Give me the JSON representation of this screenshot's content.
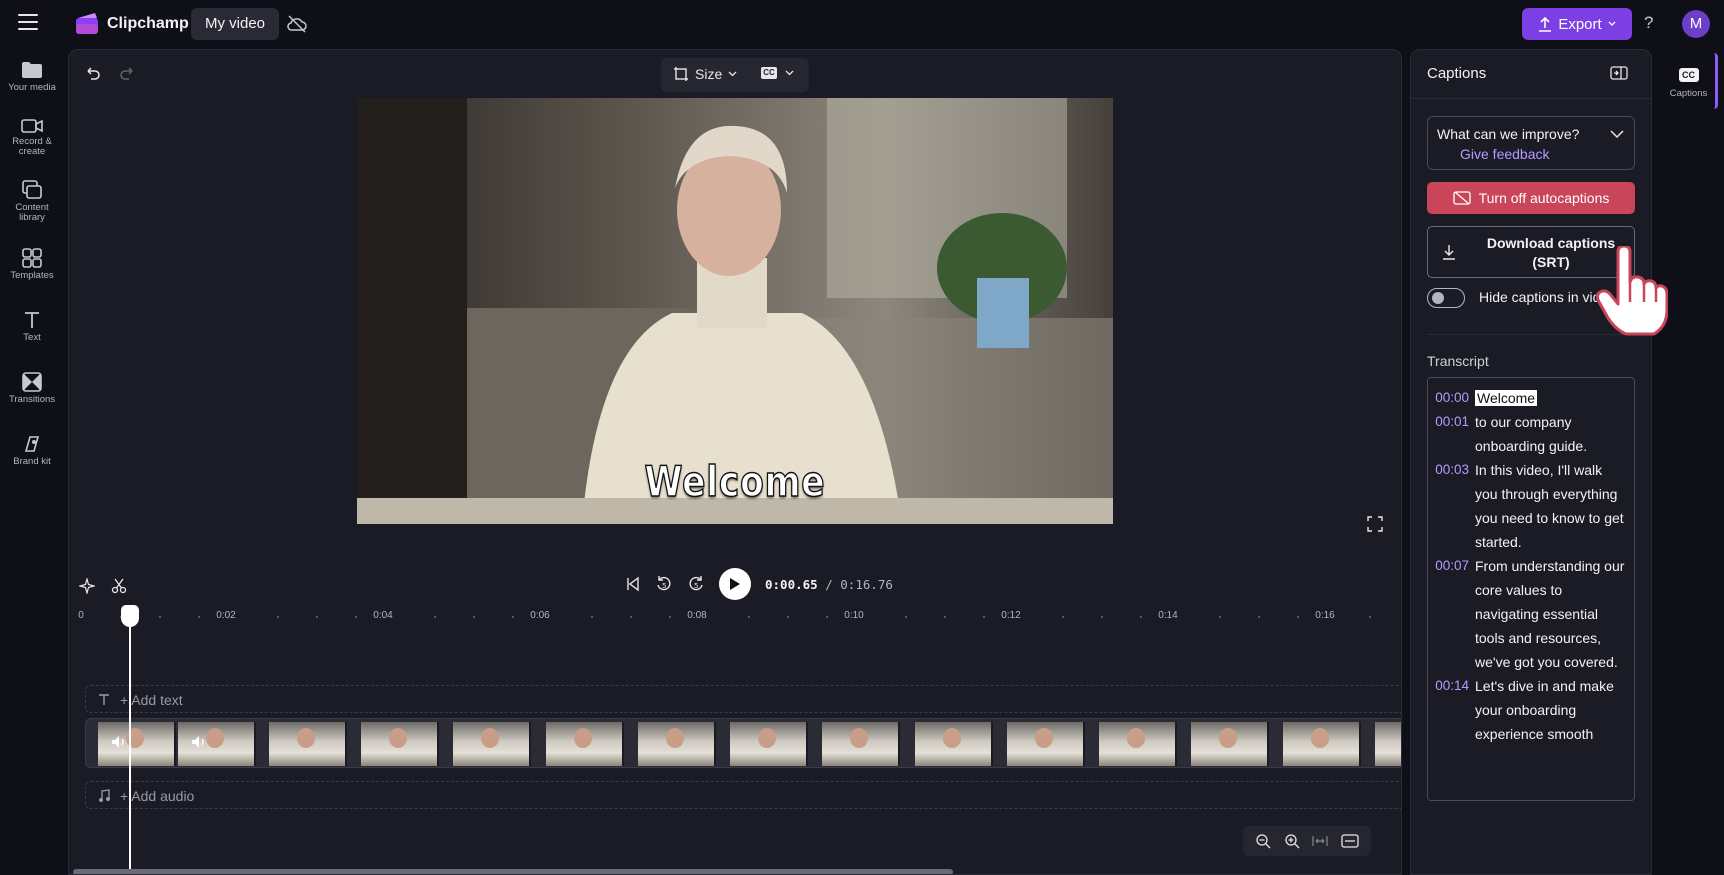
{
  "app": {
    "title": "Clipchamp",
    "project_name": "My video"
  },
  "header": {
    "export_label": "Export",
    "help_glyph": "?",
    "avatar_initial": "M"
  },
  "nav": {
    "items": [
      {
        "label": "Your media"
      },
      {
        "label": "Record &\ncreate"
      },
      {
        "label": "Content\nlibrary"
      },
      {
        "label": "Templates"
      },
      {
        "label": "Text"
      },
      {
        "label": "Transitions"
      },
      {
        "label": "Brand kit"
      }
    ]
  },
  "toolbar": {
    "size_label": "Size",
    "cc_label": "CC"
  },
  "preview": {
    "caption_text": "Welcome"
  },
  "playback": {
    "current_time": "0:00.65",
    "total_time": "/ 0:16.76"
  },
  "ruler": {
    "labels": [
      "0",
      "0:02",
      "0:04",
      "0:06",
      "0:08",
      "0:10",
      "0:12",
      "0:14",
      "0:16"
    ]
  },
  "tracks": {
    "add_text": "+ Add text",
    "add_audio": "+ Add audio"
  },
  "captions_panel": {
    "title": "Captions",
    "feedback_question": "What can we improve?",
    "feedback_link": "Give feedback",
    "autocaptions_button": "Turn off autocaptions",
    "download_button": "Download captions (SRT)",
    "hide_toggle_label": "Hide captions in video",
    "hide_toggle_on": false,
    "transcript_title": "Transcript",
    "transcript": [
      {
        "time": "00:00",
        "text": "Welcome",
        "active": true
      },
      {
        "time": "00:01",
        "text": "to our company onboarding guide."
      },
      {
        "time": "00:03",
        "text": "In this video, I'll walk you through everything you need to know to get started."
      },
      {
        "time": "00:07",
        "text": "From understanding our core values to navigating essential tools and resources, we've got you covered."
      },
      {
        "time": "00:14",
        "text": "Let's dive in and make your onboarding experience smooth"
      }
    ]
  },
  "right_rail": {
    "tab_label": "Captions",
    "tab_badge": "CC"
  },
  "colors": {
    "accent": "#7b3fe4",
    "autocaption_red": "#c8455a",
    "link_purple": "#b79aff",
    "background": "#0f0f17",
    "panel": "#1b1b25"
  }
}
